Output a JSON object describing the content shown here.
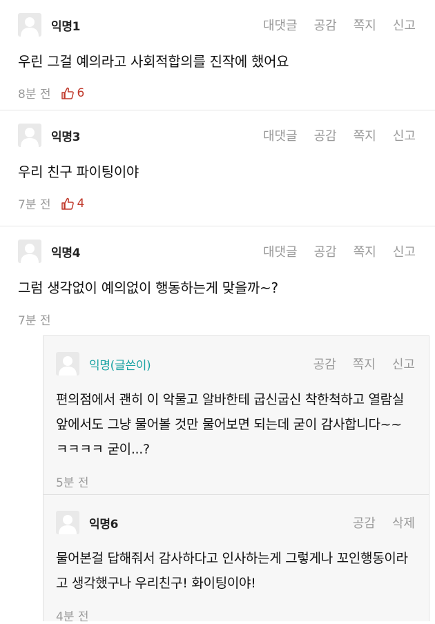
{
  "actions": {
    "reply": "대댓글",
    "like": "공감",
    "message": "쪽지",
    "report": "신고",
    "delete": "삭제"
  },
  "comments": [
    {
      "author": "익명1",
      "text": "우린 그걸 예의라고 사회적합의를 진작에 했어요",
      "time": "8분 전",
      "likes": "6"
    },
    {
      "author": "익명3",
      "text": "우리 친구 파이팅이야",
      "time": "7분 전",
      "likes": "4"
    },
    {
      "author": "익명4",
      "text": "그럼 생각없이 예의없이 행동하는게 맞을까~?",
      "time": "7분 전"
    }
  ],
  "replies": [
    {
      "author": "익명(글쓴이)",
      "text": "편의점에서 괜히 이 악물고 알바한테 굽신굽신 착한척하고 열람실 앞에서도 그냥 물어볼 것만 물어보면 되는데 굳이 감사합니다~~ ㅋㅋㅋㅋ 굳이...?",
      "time": "5분 전"
    },
    {
      "author": "익명6",
      "text": "물어본걸 답해줘서 감사하다고 인사하는게 그렇게나 꼬인행동이라고 생각했구나 우리친구! 화이팅이야!",
      "time": "4분 전"
    }
  ],
  "colors": {
    "writer_name": "#1aa3a3",
    "like_accent": "#c0392b",
    "muted": "#9a9a9a"
  }
}
